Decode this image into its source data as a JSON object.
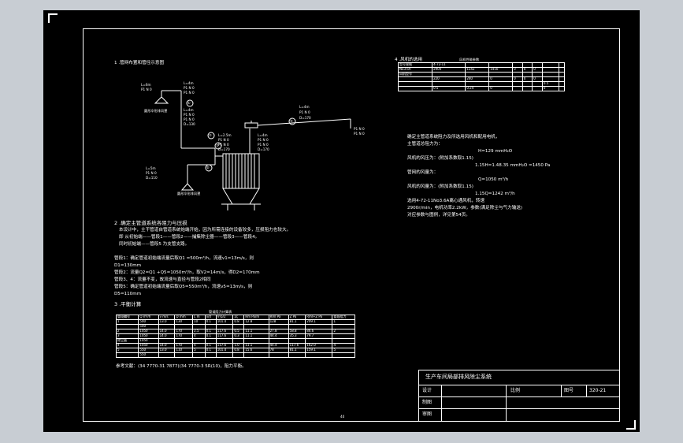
{
  "drawing": {
    "section1_title": "1 .管网布置和管径示意图",
    "section2_title": "2 .确定主管道系统各阻力与压损",
    "section2_lines": [
      "本设计中，主干管道自管道系统始端开始，因为所需连接的设备较多，压损阻力也较大。",
      "即 从初始端——管段1——管段2——捕集除尘器——管段3——管段4。",
      "同时初始端——管段5 为支管支路。"
    ],
    "calc_lines": [
      "管段1：确定管道初始端流量后取Q1 =500m³/h，流速v1=13m/s，则",
      "D1=130mm",
      "管段2：流量Q2=Q1 +Q5=1050m³/h，取V2=14m/s，得D2=170mm",
      "管段3、4：流量不变，故流速与直径与管段2相同",
      "管段5：确定管道初始端流量后取Q5=550m³/h，流速v5=13m/s，则",
      "D5=110mm"
    ],
    "section3_title": "3 .平衡计算",
    "bottom_note": "参考文献：(34 7770-31 7877)(34 7770-3 5R(10)，阻力平衡。",
    "page_number": "40",
    "right_title": "4 .风机的选用",
    "right_lines": [
      "确定主管道系统阻力及所选用风机和配用电机，",
      "主管道总阻力为：",
      "H=129 mmH₂O",
      "风机的风压为：(附加系数取1.15)",
      "1.15H=1.48.35 mmH₂O =1450 Pa",
      "管网的风量为：",
      "Q=1050 m³/h",
      "风机的风量为：(附加系数取1.15)",
      "1.15Q=1242 m³/h",
      "选用4-72-11No3.6A离心通风机，转速",
      "2900r/min，电机功率2.2kW，参数(满足除尘与气力输送)",
      "对应参数与图例，详见第54页。"
    ],
    "diagram_labels": {
      "a1": "L=6m",
      "a1b": "P1 N 0",
      "a2": "L=4m",
      "a2b": "P1 N 0",
      "a2c": "P1 N 0",
      "hood1": "圆形伞形排风罩",
      "n1": "①",
      "b1": "L=4m",
      "b1b": "P1 N 0",
      "b1c": "P1 N 0",
      "b1d": "D=130",
      "n2": "②",
      "c1": "L=2.5m",
      "c1b": "P1 N 0",
      "c1c": "P1 N 0",
      "c1d": "D=170",
      "n3": "③",
      "d1": "L=4m",
      "d1b": "P1 N 0",
      "d1c": "P1 N 0",
      "d1d": "D=170",
      "n4": "④",
      "e1": "L=4m",
      "e1b": "P1 N 0",
      "e1c": "D=170",
      "hood2": "圆形伞形排风罩",
      "n5": "⑤",
      "f1": "L=5m",
      "f1b": "P1 N 0",
      "f1c": "D=110",
      "outlet": "P1 N 0",
      "outlet2": "P1 N 0"
    },
    "fan_table": {
      "title": "风机性能参数",
      "rows": [
        [
          "型号规格",
          "4-72-11",
          "",
          "",
          "",
          "",
          "",
          "",
          ""
        ],
        [
          "No3.6A",
          "2900",
          "1242",
          "1450",
          "0",
          "0",
          "0",
          "",
          ""
        ],
        [
          "风机型号",
          "",
          "",
          "",
          "",
          "",
          "",
          "",
          ""
        ],
        [
          "",
          "220",
          "240",
          "0",
          "0",
          "0",
          "0",
          "",
          ""
        ],
        [
          "",
          "",
          "",
          "",
          "",
          "",
          "",
          "0.5",
          ""
        ],
        [
          "",
          "0.5",
          "0.24",
          "0",
          "",
          "",
          "",
          "0",
          ""
        ]
      ]
    },
    "calc_table": {
      "title": "管道阻力计算表",
      "header": [
        "管段编号",
        "Q m³/h",
        "v m/s",
        "D mm",
        "L m",
        "λ/d",
        "V²ρ/2",
        "Σζ",
        "Rm Pa/m",
        "Rml Pa",
        "Z Pa",
        "Rml+Z Pa",
        "管段阻力"
      ],
      "rows": [
        [
          "1",
          "500",
          "13.0",
          "130",
          "10",
          "0.1",
          "101.4",
          "0.8",
          "12.8",
          "128",
          "81.1",
          "209.1",
          "1"
        ],
        [
          "",
          "500",
          "",
          "",
          "",
          "",
          "",
          "",
          "",
          "",
          "",
          "",
          ""
        ],
        [
          "2",
          "1050",
          "14.0",
          "170",
          "2.5",
          "0.1",
          "117.6",
          "0.5",
          "11.1",
          "27.8",
          "58.8",
          "86.6",
          "2"
        ],
        [
          "3",
          "1050",
          "14.0",
          "170",
          "4",
          "0.1",
          "117.6",
          "0.3",
          "11.1",
          "44.4",
          "35.3",
          "79.7",
          ""
        ],
        [
          "除尘器",
          "1050",
          "",
          "",
          "",
          "",
          "",
          "",
          "",
          "",
          "",
          "",
          ""
        ],
        [
          "4",
          "1050",
          "14.0",
          "170",
          "4",
          "0.1",
          "117.6",
          "1.0",
          "11.1",
          "44.4",
          "117.6",
          "162.0",
          "4"
        ],
        [
          "5",
          "550",
          "13.0",
          "110",
          "5",
          "0.1",
          "101.4",
          "0.8",
          "15.6",
          "78",
          "81.1",
          "159.1",
          "5"
        ],
        [
          "",
          "550",
          "",
          "",
          "",
          "",
          "",
          "",
          "",
          "",
          "",
          "",
          ""
        ]
      ]
    },
    "title_block": {
      "title": "生产车间局部排风除尘系统",
      "scale_label": "比例",
      "drawing_no_label": "图号",
      "drawing_no": "320-21",
      "design_label": "设计",
      "draw_label": "制图",
      "review_label": "审图"
    }
  }
}
